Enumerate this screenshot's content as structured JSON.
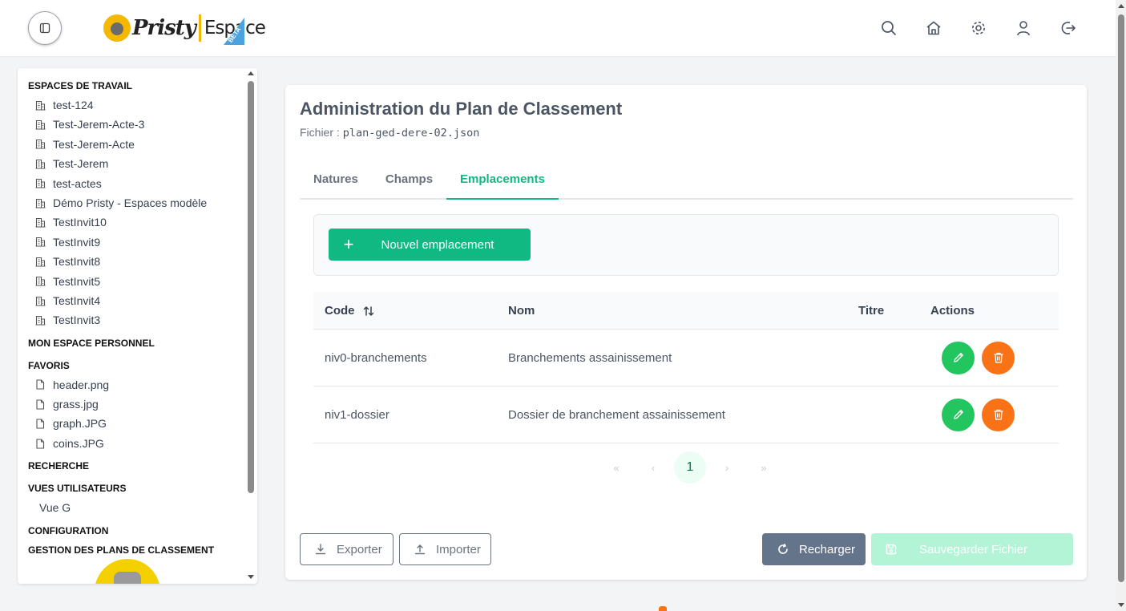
{
  "header": {
    "logo_word": "Pristy",
    "logo_espace": "Espace",
    "logo_beta": "BETA",
    "icons": [
      "search-icon",
      "home-icon",
      "settings-icon",
      "user-icon",
      "logout-icon"
    ]
  },
  "sidebar": {
    "workspaces_heading": "ESPACES DE TRAVAIL",
    "workspaces": [
      "test-124",
      "Test-Jerem-Acte-3",
      "Test-Jerem-Acte",
      "Test-Jerem",
      "test-actes",
      "Démo Pristy - Espaces modèle",
      "TestInvit10",
      "TestInvit9",
      "TestInvit8",
      "TestInvit5",
      "TestInvit4",
      "TestInvit3"
    ],
    "personal_heading": "MON ESPACE PERSONNEL",
    "favorites_heading": "FAVORIS",
    "favorites": [
      "header.png",
      "grass.jpg",
      "graph.JPG",
      "coins.JPG"
    ],
    "search_heading": "RECHERCHE",
    "views_heading": "VUES UTILISATEURS",
    "views": [
      "Vue G"
    ],
    "config_heading": "CONFIGURATION",
    "plans_heading": "GESTION DES PLANS DE CLASSEMENT"
  },
  "main": {
    "title": "Administration du Plan de Classement",
    "file_label": "Fichier :",
    "file_name": "plan-ged-dere-02.json",
    "tabs": [
      "Natures",
      "Champs",
      "Emplacements"
    ],
    "active_tab": "Emplacements",
    "new_button": "Nouvel emplacement",
    "table": {
      "headers": {
        "code": "Code",
        "nom": "Nom",
        "titre": "Titre",
        "actions": "Actions"
      },
      "rows": [
        {
          "code": "niv0-branchements",
          "nom": "Branchements assainissement",
          "titre": ""
        },
        {
          "code": "niv1-dossier",
          "nom": "Dossier de branchement assainissement",
          "titre": ""
        }
      ]
    },
    "pagination": {
      "current_page": "1"
    },
    "buttons": {
      "export": "Exporter",
      "import": "Importer",
      "reload": "Recharger",
      "save": "Sauvegarder Fichier"
    }
  },
  "colors": {
    "accent": "#10b981",
    "edit": "#22c55e",
    "delete": "#f97316",
    "reload": "#64748b"
  }
}
